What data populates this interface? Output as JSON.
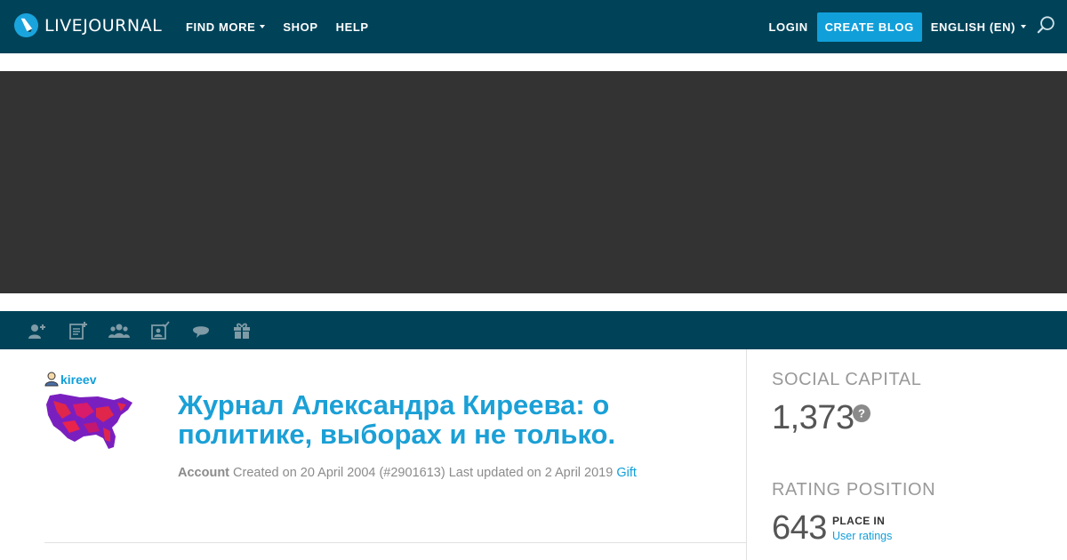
{
  "header": {
    "logo_text": "LIVEJOURNAL",
    "nav": [
      {
        "label": "FIND MORE",
        "has_dropdown": true
      },
      {
        "label": "SHOP",
        "has_dropdown": false
      },
      {
        "label": "HELP",
        "has_dropdown": false
      }
    ],
    "login_label": "LOGIN",
    "create_blog_label": "CREATE BLOG",
    "language_label": "ENGLISH (EN)",
    "search_icon": "search-icon"
  },
  "banner": {
    "color": "#333333"
  },
  "toolbar": {
    "icons": [
      "add-friend-icon",
      "add-entry-icon",
      "community-icon",
      "subscribe-icon",
      "message-icon",
      "gift-icon"
    ]
  },
  "profile": {
    "username": "kireev",
    "journal_title": "Журнал Александра Киреева: о политике, выборах и не только.",
    "account_label": "Account",
    "created_text": "Created on 20 April 2004 (#2901613)",
    "updated_text": "Last updated on 2 April 2019",
    "gift_label": "Gift"
  },
  "stats": {
    "social_capital_heading": "SOCIAL CAPITAL",
    "social_capital_value": "1,373",
    "rating_heading": "RATING POSITION",
    "rating_value": "643",
    "place_in_label": "PLACE IN",
    "user_ratings_link": "User ratings"
  },
  "colors": {
    "nav_bg": "#004359",
    "accent": "#119fda",
    "title": "#1ba0d6",
    "banner": "#333333"
  }
}
